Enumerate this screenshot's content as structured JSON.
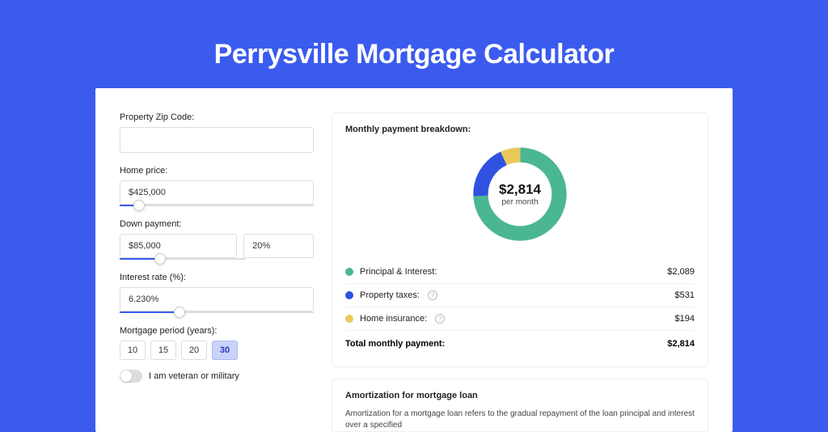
{
  "title": "Perrysville Mortgage Calculator",
  "form": {
    "zip_label": "Property Zip Code:",
    "zip_value": "",
    "price_label": "Home price:",
    "price_value": "$425,000",
    "down_label": "Down payment:",
    "down_value": "$85,000",
    "down_pct": "20%",
    "rate_label": "Interest rate (%):",
    "rate_value": "6.230%",
    "period_label": "Mortgage period (years):",
    "periods": [
      "10",
      "15",
      "20",
      "30"
    ],
    "period_active": "30",
    "veteran_label": "I am veteran or military"
  },
  "breakdown": {
    "title": "Monthly payment breakdown:",
    "center_amount": "$2,814",
    "center_sub": "per month",
    "items": [
      {
        "label": "Principal & Interest:",
        "value": "$2,089",
        "color": "green",
        "info": false
      },
      {
        "label": "Property taxes:",
        "value": "$531",
        "color": "blue",
        "info": true
      },
      {
        "label": "Home insurance:",
        "value": "$194",
        "color": "yellow",
        "info": true
      }
    ],
    "total_label": "Total monthly payment:",
    "total_value": "$2,814"
  },
  "amort": {
    "title": "Amortization for mortgage loan",
    "text": "Amortization for a mortgage loan refers to the gradual repayment of the loan principal and interest over a specified"
  },
  "chart_data": {
    "type": "pie",
    "title": "Monthly payment breakdown",
    "series": [
      {
        "name": "Principal & Interest",
        "value": 2089,
        "color": "#4BB693"
      },
      {
        "name": "Property taxes",
        "value": 531,
        "color": "#2F52E0"
      },
      {
        "name": "Home insurance",
        "value": 194,
        "color": "#E9C95B"
      }
    ],
    "total": 2814
  }
}
